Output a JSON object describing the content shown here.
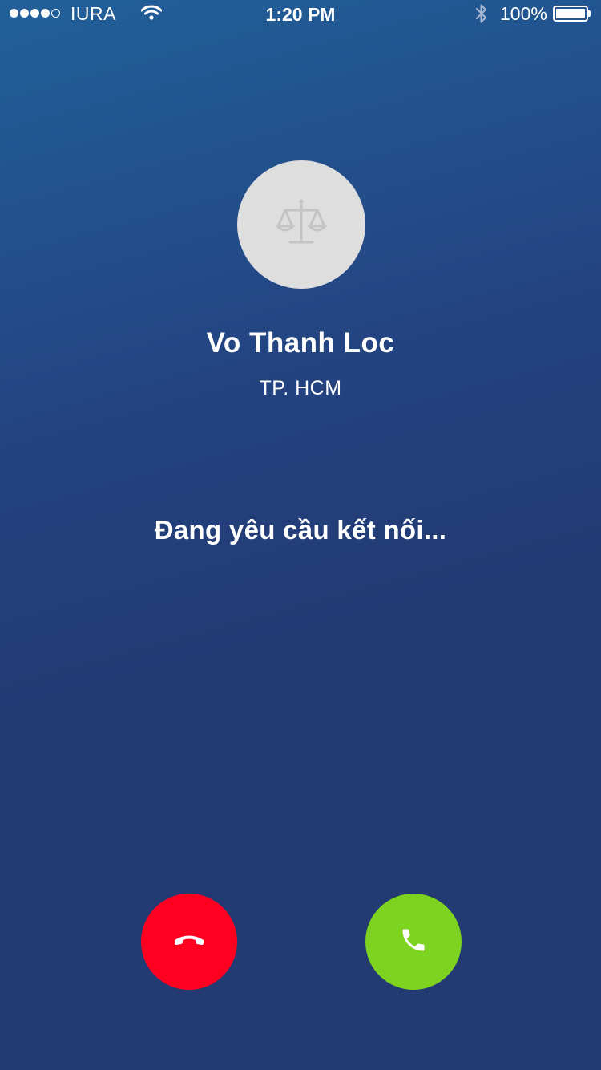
{
  "status_bar": {
    "carrier": "IURA",
    "time": "1:20 PM",
    "battery": "100%",
    "signal_bars_filled": 4,
    "signal_bars_total": 5,
    "icons": [
      "wifi-icon",
      "bluetooth-icon",
      "battery-icon"
    ]
  },
  "caller": {
    "name": "Vo Thanh Loc",
    "location": "TP. HCM",
    "avatar_icon": "scales-of-justice-icon"
  },
  "call": {
    "status": "Đang yêu cầu kết nối..."
  },
  "actions": {
    "decline_icon": "hang-up-icon",
    "accept_icon": "phone-icon"
  },
  "colors": {
    "background_top": "#22609a",
    "background_bottom": "#233a72",
    "decline": "#ff0120",
    "accept": "#7ed321",
    "avatar_bg": "#dedede"
  }
}
